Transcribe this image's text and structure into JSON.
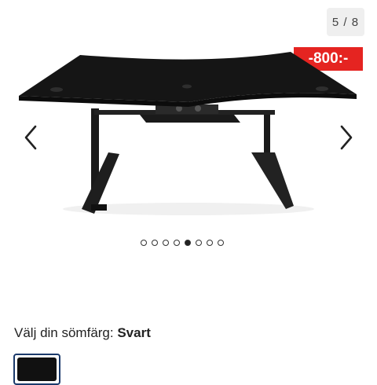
{
  "gallery": {
    "counter": "5 / 8",
    "price_badge": "-800:-",
    "total_images": 8,
    "active_index": 5,
    "prev_icon": "chevron-left-icon",
    "next_icon": "chevron-right-icon"
  },
  "color_selector": {
    "label": "Välj din sömfärg:",
    "selected_value": "Svart",
    "swatches": [
      {
        "color": "#111111",
        "selected": true
      }
    ]
  },
  "colors": {
    "sale_badge": "#e52421",
    "swatch_border": "#1b3a6b",
    "counter_bg": "#efefef"
  }
}
